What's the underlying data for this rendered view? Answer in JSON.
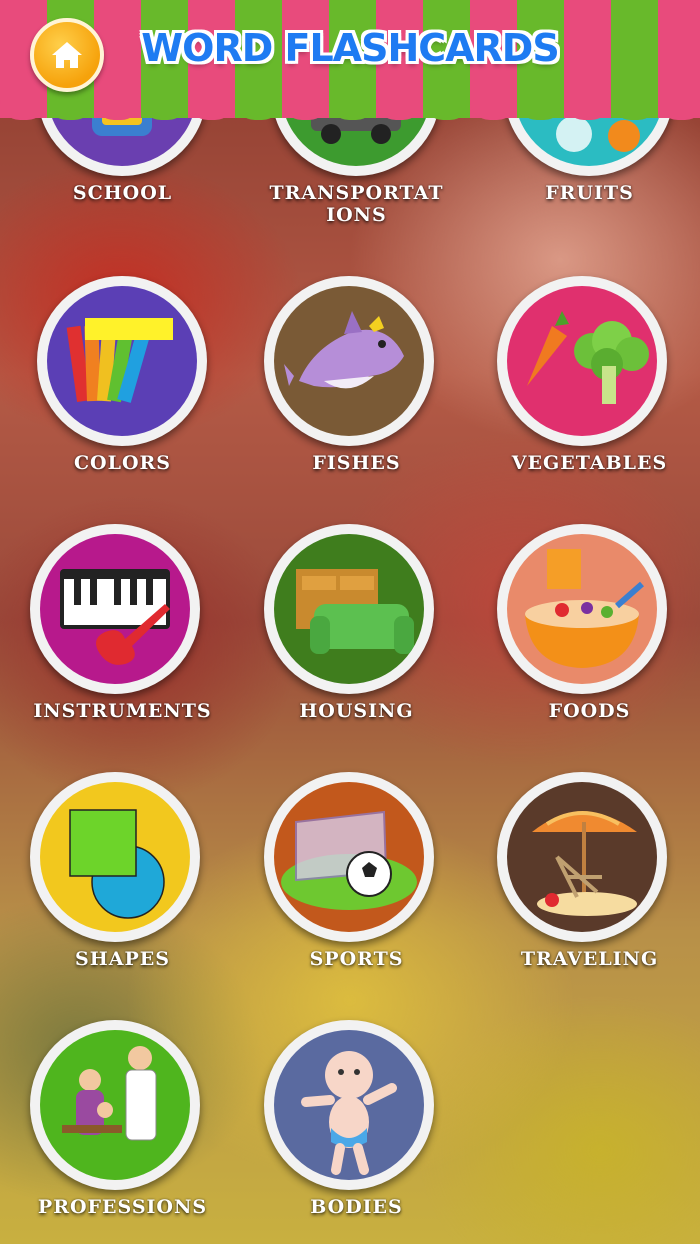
{
  "header": {
    "title": "WORD FLASHCARDS",
    "home_icon": "home-icon"
  },
  "colors": {
    "stripe_pink": "#e84b7c",
    "stripe_green": "#68b92b",
    "title_blue": "#1e7bf2",
    "home_orange": "#f6a20b"
  },
  "categories": [
    {
      "label": "SCHOOL",
      "icon": "school-bag-icon",
      "bg": "#6a3fb0"
    },
    {
      "label": "TRANSPORTAT IONS",
      "icon": "car-icon",
      "bg": "#3d9b2f"
    },
    {
      "label": "FRUITS",
      "icon": "fruit-icon",
      "bg": "#2bbcc2"
    },
    {
      "label": "COLORS",
      "icon": "color-palette-icon",
      "bg": "#5b3fb5"
    },
    {
      "label": "FISHES",
      "icon": "dolphin-icon",
      "bg": "#7a5a36"
    },
    {
      "label": "VEGETABLES",
      "icon": "vegetables-icon",
      "bg": "#e0306e"
    },
    {
      "label": "INSTRUMENTS",
      "icon": "piano-guitar-icon",
      "bg": "#b7198c"
    },
    {
      "label": "HOUSING",
      "icon": "furniture-icon",
      "bg": "#3f7d1d"
    },
    {
      "label": "FOODS",
      "icon": "food-bowl-icon",
      "bg": "#e98a6a"
    },
    {
      "label": "SHAPES",
      "icon": "shapes-icon",
      "bg": "#f2c81e"
    },
    {
      "label": "SPORTS",
      "icon": "soccer-goal-icon",
      "bg": "#c2581c"
    },
    {
      "label": "TRAVELING",
      "icon": "beach-umbrella-icon",
      "bg": "#5a3a2a"
    },
    {
      "label": "PROFESSIONS",
      "icon": "doctor-icon",
      "bg": "#4fb51e"
    },
    {
      "label": "BODIES",
      "icon": "baby-icon",
      "bg": "#5a6aa0"
    }
  ]
}
